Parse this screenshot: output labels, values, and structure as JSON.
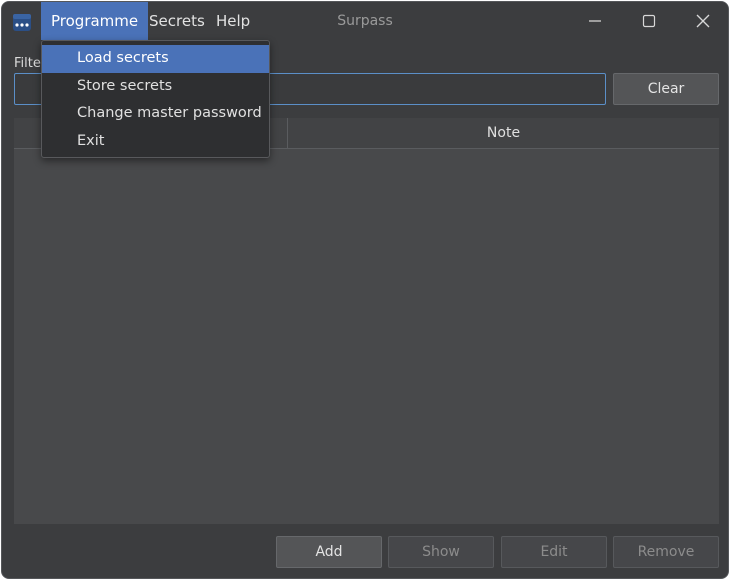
{
  "window": {
    "title": "Surpass",
    "accent_color": "#4a72b8"
  },
  "app_icon": {
    "name": "surpass-app-icon",
    "glyph": "***"
  },
  "menubar": {
    "items": [
      {
        "label": "Programme",
        "active": true
      },
      {
        "label": "Secrets",
        "active": false
      },
      {
        "label": "Help",
        "active": false
      }
    ]
  },
  "window_controls": {
    "minimize": "minimize-icon",
    "maximize": "maximize-icon",
    "close": "close-icon"
  },
  "programme_menu": {
    "items": [
      {
        "label": "Load secrets",
        "highlighted": true
      },
      {
        "label": "Store secrets",
        "highlighted": false
      },
      {
        "label": "Change master password",
        "highlighted": false
      },
      {
        "label": "Exit",
        "highlighted": false
      }
    ]
  },
  "filter": {
    "label": "Filte",
    "value": "",
    "clear_label": "Clear"
  },
  "table": {
    "columns": [
      {
        "label": ""
      },
      {
        "label": "Note"
      }
    ],
    "rows": []
  },
  "actions": {
    "add_label": "Add",
    "show_label": "Show",
    "edit_label": "Edit",
    "remove_label": "Remove"
  }
}
